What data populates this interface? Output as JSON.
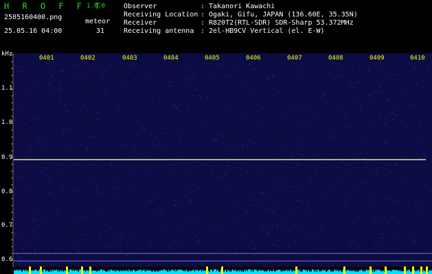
{
  "header": {
    "logo": "H R O F F T",
    "version": "1.0.0",
    "filename": "2505160400.png",
    "datetime": "25.05.16 04:00",
    "count_label": "meteor",
    "count_value": "31",
    "info": [
      {
        "label": "Observer",
        "value": "Takanori Kawachi"
      },
      {
        "label": "Receiving Location",
        "value": "Ogaki, Gifu, JAPAN (136.60E, 35.35N)"
      },
      {
        "label": "Receiver",
        "value": "R820T2(RTL-SDR) SDR-Sharp 53.372MHz"
      },
      {
        "label": "Receiving antenna",
        "value": "2el-HB9CV Vertical (el. E-W)"
      }
    ]
  },
  "spectrogram": {
    "y_unit": "kHz",
    "y_ticks": [
      "1.1",
      "1.0",
      "0.9",
      "0.8",
      "0.7",
      "0.6"
    ],
    "time_ticks": [
      "0401",
      "0402",
      "0403",
      "0404",
      "0405",
      "0406",
      "0407",
      "0408",
      "0409",
      "0410"
    ],
    "carrier_khz": 0.893,
    "colors": {
      "background": "#0c0c44",
      "noise": "#2a2aa6",
      "carrier": "#c8f0a0",
      "time_label": "#ffff00",
      "level_trace": "#00e0ff",
      "level_peak": "#ffff00"
    }
  }
}
